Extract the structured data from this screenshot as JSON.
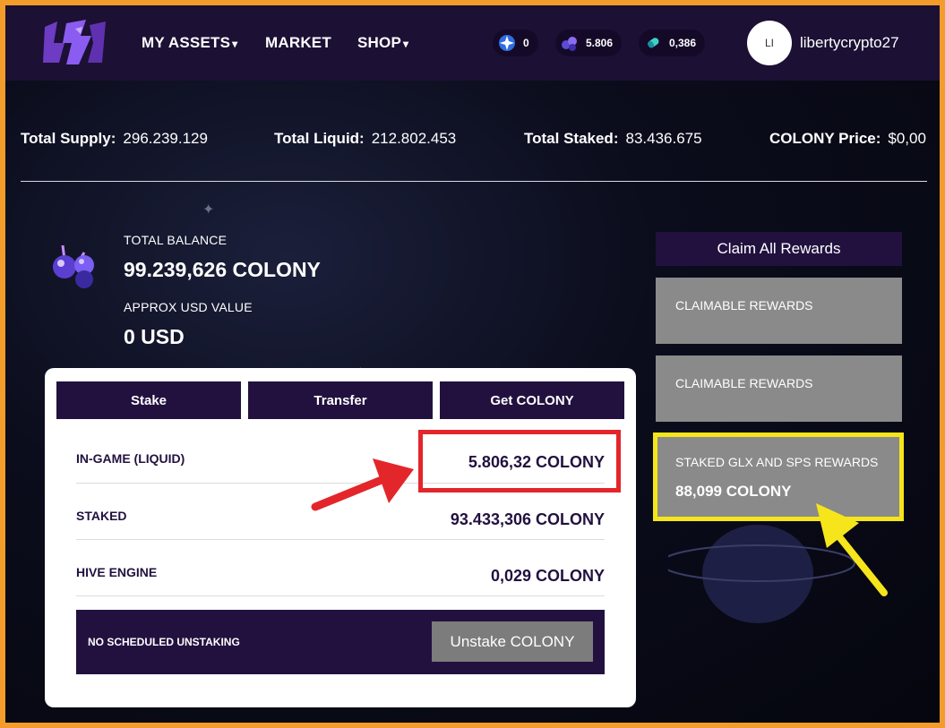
{
  "nav": {
    "items": [
      {
        "label": "MY ASSETS",
        "chevron": true
      },
      {
        "label": "MARKET",
        "chevron": false
      },
      {
        "label": "SHOP",
        "chevron": true
      }
    ],
    "resources": [
      {
        "icon": "star-token-icon",
        "value": "0"
      },
      {
        "icon": "crystal-cluster-icon",
        "value": "5.806"
      },
      {
        "icon": "capsule-icon",
        "value": "0,386"
      }
    ],
    "avatar_initials": "LI",
    "username": "libertycrypto27"
  },
  "stats": [
    {
      "label": "Total Supply:",
      "value": "296.239.129"
    },
    {
      "label": "Total Liquid:",
      "value": "212.802.453"
    },
    {
      "label": "Total Staked:",
      "value": "83.436.675"
    },
    {
      "label": "COLONY Price:",
      "value": "$0,00"
    }
  ],
  "balance": {
    "total_label": "TOTAL BALANCE",
    "total_value": "99.239,626 COLONY",
    "usd_label": "APPROX USD VALUE",
    "usd_value": "0 USD"
  },
  "card": {
    "tabs": [
      "Stake",
      "Transfer",
      "Get COLONY"
    ],
    "rows": [
      {
        "label": "IN-GAME (LIQUID)",
        "value": "5.806,32 COLONY"
      },
      {
        "label": "STAKED",
        "value": "93.433,306 COLONY"
      },
      {
        "label": "HIVE ENGINE",
        "value": "0,029 COLONY"
      }
    ],
    "unstaking_label": "NO SCHEDULED UNSTAKING",
    "unstake_button": "Unstake COLONY"
  },
  "rewards": {
    "claim_all": "Claim All Rewards",
    "cards": [
      {
        "title": "CLAIMABLE REWARDS",
        "value": ""
      },
      {
        "title": "CLAIMABLE REWARDS",
        "value": ""
      },
      {
        "title": "STAKED GLX AND SPS REWARDS",
        "value": "88,099 COLONY"
      }
    ]
  },
  "colors": {
    "accent_dark": "#22113f",
    "annotation_red": "#e3262a",
    "annotation_yellow": "#f6e51a",
    "frame_orange": "#f39c2b"
  }
}
